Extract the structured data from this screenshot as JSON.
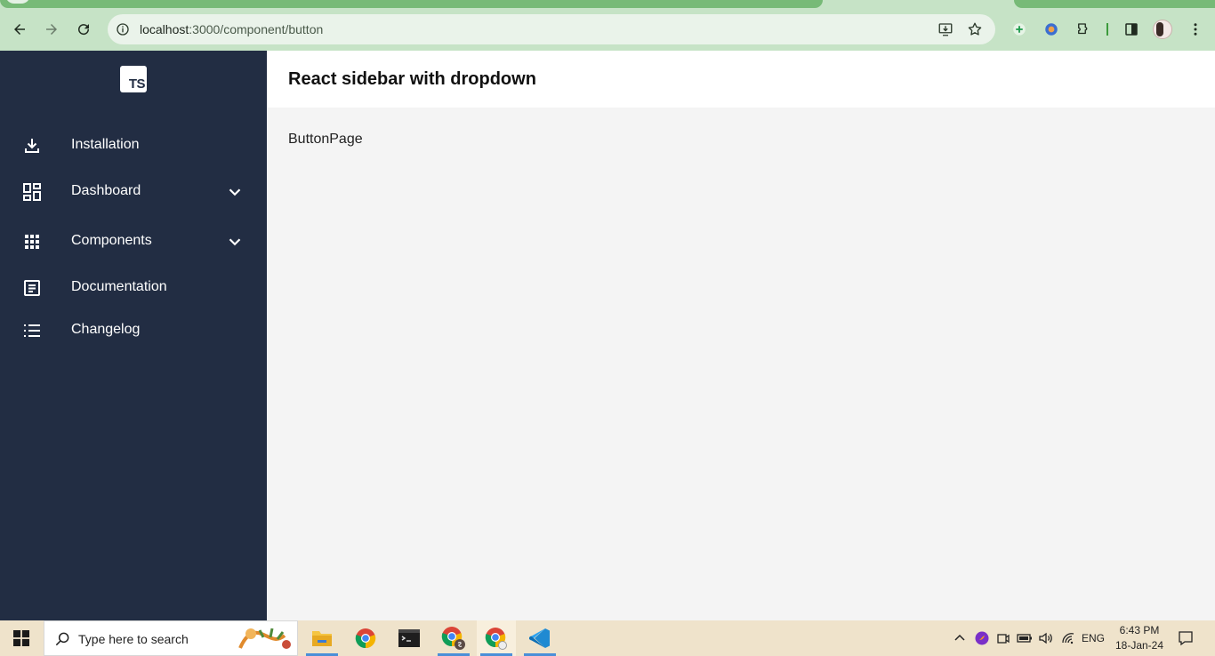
{
  "browser": {
    "url_host": "localhost",
    "url_path": ":3000/component/button"
  },
  "sidebar": {
    "logo_text": "TS",
    "items": [
      {
        "label": "Installation",
        "icon": "download-icon",
        "has_dropdown": false
      },
      {
        "label": "Dashboard",
        "icon": "dashboard-icon",
        "has_dropdown": true
      },
      {
        "label": "Components",
        "icon": "apps-grid-icon",
        "has_dropdown": true
      },
      {
        "label": "Documentation",
        "icon": "document-icon",
        "has_dropdown": false
      },
      {
        "label": "Changelog",
        "icon": "list-icon",
        "has_dropdown": false
      }
    ]
  },
  "header": {
    "title": "React sidebar with dropdown"
  },
  "main": {
    "page_text": "ButtonPage"
  },
  "taskbar": {
    "search_placeholder": "Type here to search",
    "language": "ENG",
    "time": "6:43 PM",
    "date": "18-Jan-24"
  },
  "colors": {
    "sidebar_bg": "#222d43",
    "browser_frame": "#c6e3c6",
    "content_bg": "#f4f4f4"
  }
}
